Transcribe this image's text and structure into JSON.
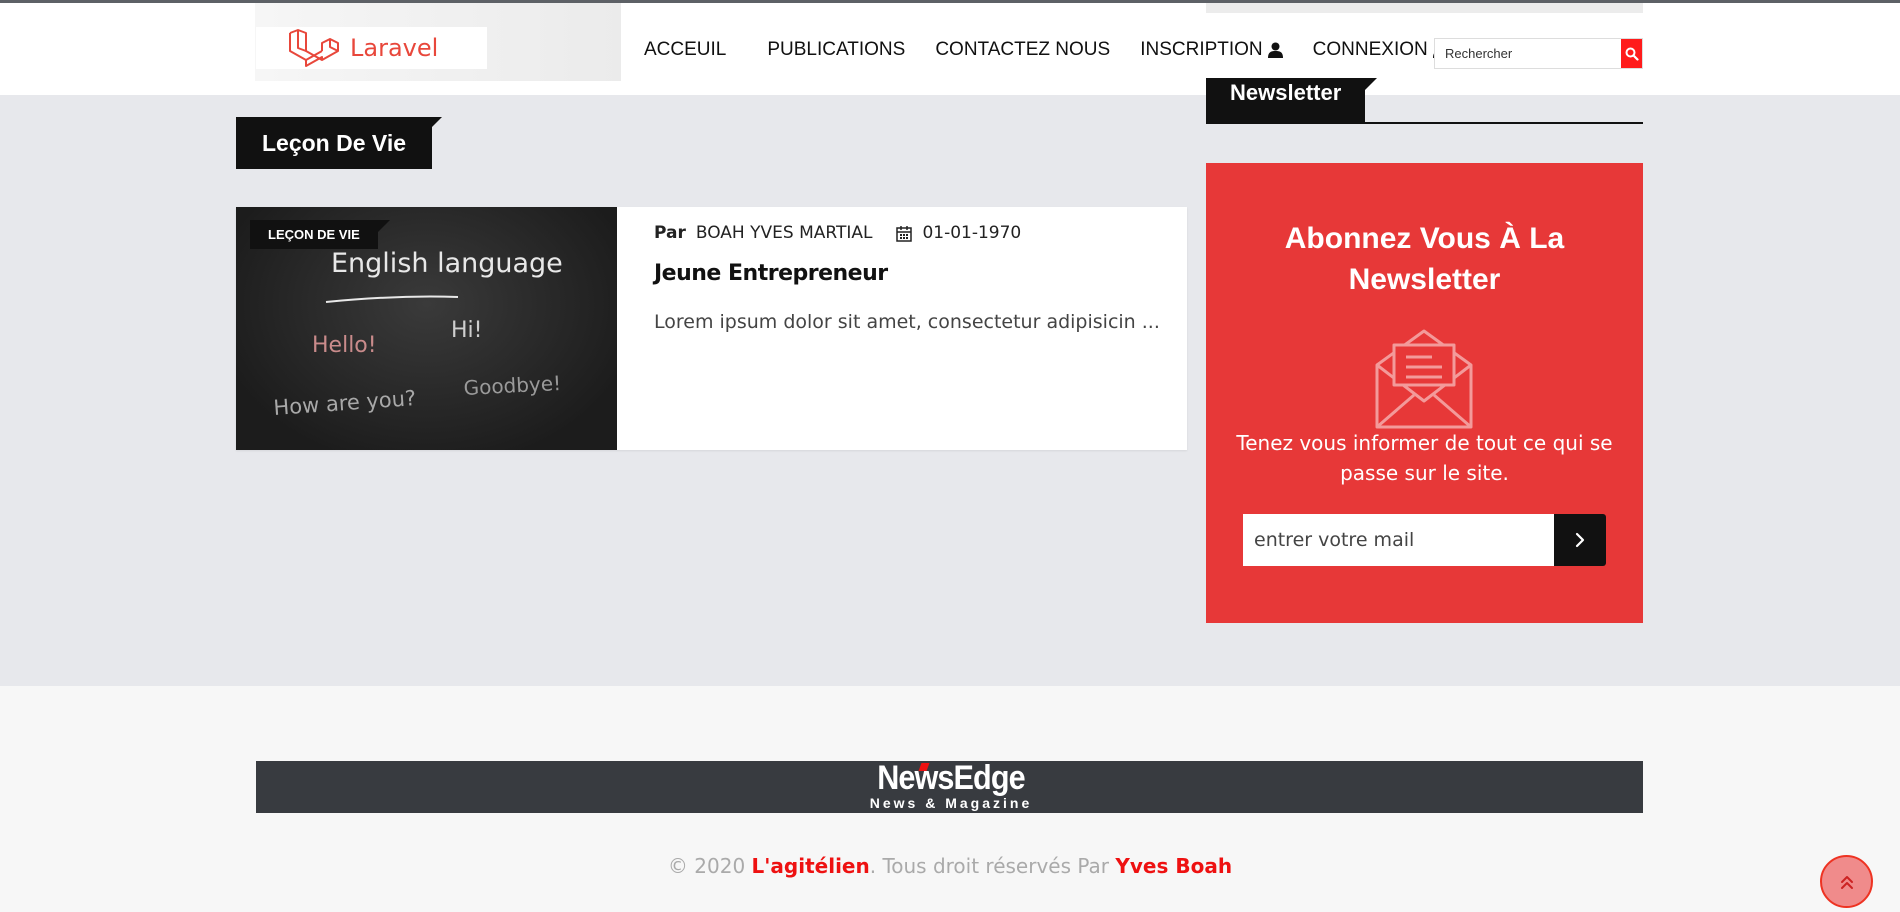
{
  "header": {
    "logo_text": "Laravel",
    "nav": [
      {
        "label": "ACCEUIL"
      },
      {
        "label": "PUBLICATIONS"
      },
      {
        "label": "CONTACTEZ NOUS"
      },
      {
        "label": "INSCRIPTION",
        "icon": "user-icon"
      },
      {
        "label": "CONNEXION",
        "icon": "user-icon"
      }
    ],
    "search": {
      "placeholder": "Rechercher",
      "icon": "search-icon"
    },
    "accent_color": "#ff1b1b"
  },
  "section": {
    "title": "Leçon De Vie"
  },
  "post": {
    "category": "LEÇON DE VIE",
    "by_label": "Par",
    "author": "BOAH YVES MARTIAL",
    "date_icon": "calendar-icon",
    "date": "01-01-1970",
    "title": "Jeune Entrepreneur",
    "excerpt": "Lorem ipsum dolor sit amet, consectetur adipisicin ...",
    "image_texts": [
      "English language",
      "Hello!",
      "Hi!",
      "How are you?",
      "Goodbye!"
    ]
  },
  "sidebar": {
    "widget_title": "Newsletter",
    "newsletter": {
      "title": "Abonnez Vous À La Newsletter",
      "icon": "envelope-icon",
      "text": "Tenez vous informer de tout ce qui se passe sur le site.",
      "input_placeholder": "entrer votre mail",
      "submit_icon": "chevron-right-icon",
      "background_color": "#e73838"
    }
  },
  "footer": {
    "logo_main": "NewsEdge",
    "logo_sub": "News & Magazine",
    "copyright_prefix": "© 2020 ",
    "site_name": "L'agitélien",
    "copyright_middle": ". Tous droit réservés Par ",
    "author_name": "Yves Boah",
    "back_to_top_icon": "double-chevron-up-icon"
  }
}
